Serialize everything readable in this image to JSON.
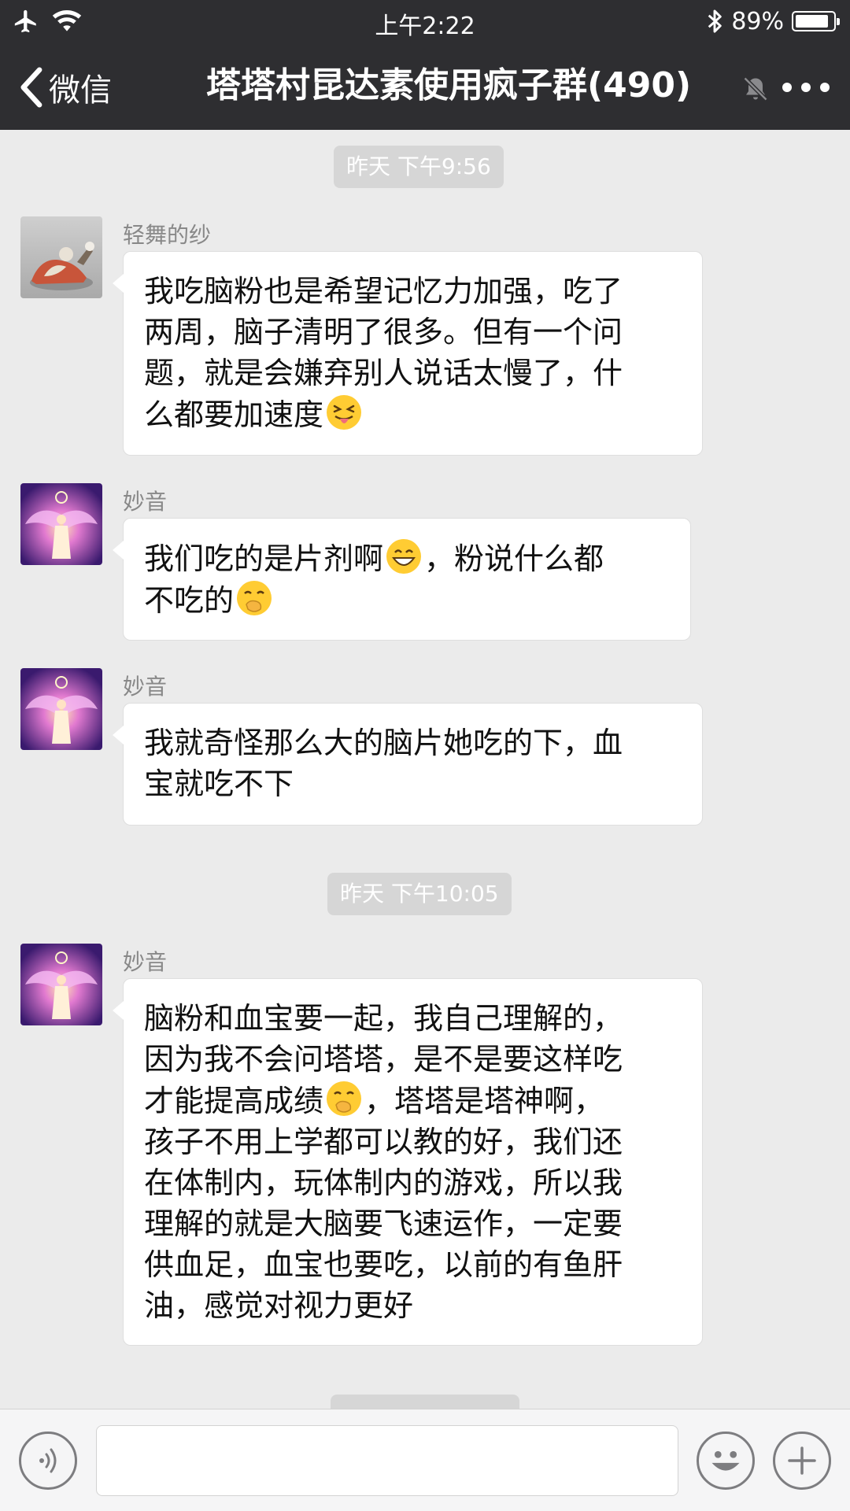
{
  "status_bar": {
    "time": "上午2:22",
    "battery_percent": "89%",
    "battery_level": 0.89,
    "icons": [
      "airplane-icon",
      "wifi-icon",
      "bluetooth-icon",
      "battery-icon"
    ]
  },
  "nav": {
    "back_label": "微信",
    "title": "塔塔村昆达素使用疯子群(490)",
    "icons": [
      "chevron-left-icon",
      "mute-bell-icon",
      "more-icon"
    ]
  },
  "chat": {
    "timestamps": [
      "昨天 下午9:56",
      "昨天 下午10:05"
    ],
    "messages": [
      {
        "sender": "轻舞的纱",
        "lines": [
          "我吃脑粉也是希望记忆力加强，吃了",
          "两周，脑子清明了很多。但有一个问",
          "题，就是会嫌弃别人说话太慢了，什",
          "么都要加速度"
        ],
        "trailing_emoji": "squint-tongue-emoji"
      },
      {
        "sender": "妙音",
        "line1_a": "我们吃的是片剂啊",
        "line1_emoji": "grin-emoji",
        "line1_b": "，粉说什么都",
        "line2": "不吃的",
        "line2_emoji": "hand-over-mouth-emoji"
      },
      {
        "sender": "妙音",
        "lines": [
          "我就奇怪那么大的脑片她吃的下，血",
          "宝就吃不下"
        ]
      },
      {
        "sender": "妙音",
        "lines_before": [
          "脑粉和血宝要一起，我自己理解的，",
          "因为我不会问塔塔，是不是要这样吃"
        ],
        "line3_a": "才能提高成绩",
        "line3_emoji": "hand-over-mouth-emoji",
        "line3_b": "，塔塔是塔神啊，",
        "lines_after": [
          "孩子不用上学都可以教的好，我们还",
          "在体制内，玩体制内的游戏，所以我",
          "理解的就是大脑要飞速运作，一定要",
          "供血足，血宝也要吃，以前的有鱼肝",
          "油，感觉对视力更好"
        ]
      }
    ]
  },
  "input_bar": {
    "placeholder": "",
    "icons": [
      "voice-icon",
      "emoji-icon",
      "plus-icon"
    ]
  },
  "colors": {
    "header_bg": "#2e2e31",
    "chat_bg": "#ebebeb",
    "bubble_bg": "#ffffff",
    "time_chip_bg": "#d6d6d6",
    "sender_text": "#888888"
  }
}
